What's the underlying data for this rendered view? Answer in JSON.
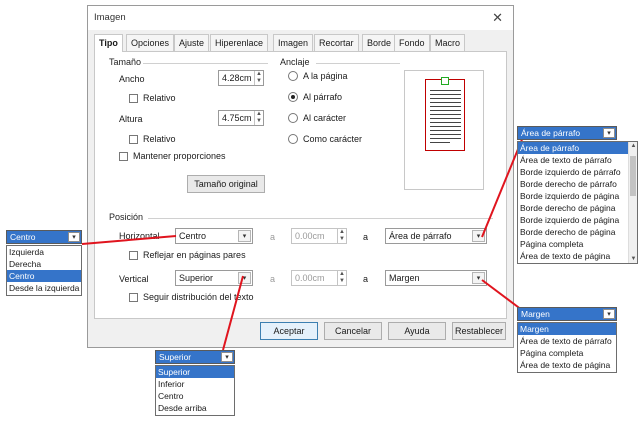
{
  "dialog": {
    "title": "Imagen",
    "close_glyph": "✕",
    "tabs": [
      "Tipo",
      "Opciones",
      "Ajuste",
      "Hiperenlace",
      "Imagen",
      "Recortar",
      "Borde",
      "Fondo",
      "Macro"
    ],
    "size": {
      "section": "Tamaño",
      "width_label": "Ancho",
      "width_value": "4.28cm",
      "relative_1": "Relativo",
      "height_label": "Altura",
      "height_value": "4.75cm",
      "relative_2": "Relativo",
      "keep_ratio": "Mantener proporciones",
      "original_size_button": "Tamaño original"
    },
    "anchor": {
      "section": "Anclaje",
      "options": [
        "A la página",
        "Al párrafo",
        "Al carácter",
        "Como carácter"
      ],
      "selected_index": 1
    },
    "position": {
      "section": "Posición",
      "horizontal_label": "Horizontal",
      "horizontal_value": "Centro",
      "h_by_label": "a",
      "h_by_value": "0.00cm",
      "h_to_label": "a",
      "h_to_value": "Área de párrafo",
      "mirror": "Reflejar en páginas pares",
      "vertical_label": "Vertical",
      "vertical_value": "Superior",
      "v_by_label": "a",
      "v_by_value": "0.00cm",
      "v_to_label": "a",
      "v_to_value": "Margen",
      "follow_text": "Seguir distribución del texto"
    },
    "buttons": {
      "ok": "Aceptar",
      "cancel": "Cancelar",
      "help": "Ayuda",
      "reset": "Restablecer"
    }
  },
  "popups": {
    "horizontal": {
      "value": "Centro",
      "items": [
        "Izquierda",
        "Derecha",
        "Centro",
        "Desde la izquierda"
      ],
      "selected_index": 2
    },
    "vertical": {
      "value": "Superior",
      "items": [
        "Superior",
        "Inferior",
        "Centro",
        "Desde arriba"
      ],
      "selected_index": 0
    },
    "horizontal_to": {
      "value": "Área de párrafo",
      "items": [
        "Área de párrafo",
        "Área de texto de párrafo",
        "Borde izquierdo de párrafo",
        "Borde derecho de párrafo",
        "Borde izquierdo de página",
        "Borde derecho de página",
        "Borde izquierdo de página",
        "Borde derecho de página",
        "Página completa",
        "Área de texto de página"
      ],
      "selected_index": 0
    },
    "vertical_to": {
      "value": "Margen",
      "items": [
        "Margen",
        "Área de texto de párrafo",
        "Página completa",
        "Área de texto de página"
      ],
      "selected_index": 0
    }
  },
  "colors": {
    "highlight": "#3574c9",
    "connector": "#e0141e",
    "anchor_frame": "#c00000",
    "anchor_marker": "#22aa22"
  },
  "icons": {
    "dropdown": "▾",
    "spin_up": "▲",
    "spin_down": "▼"
  }
}
